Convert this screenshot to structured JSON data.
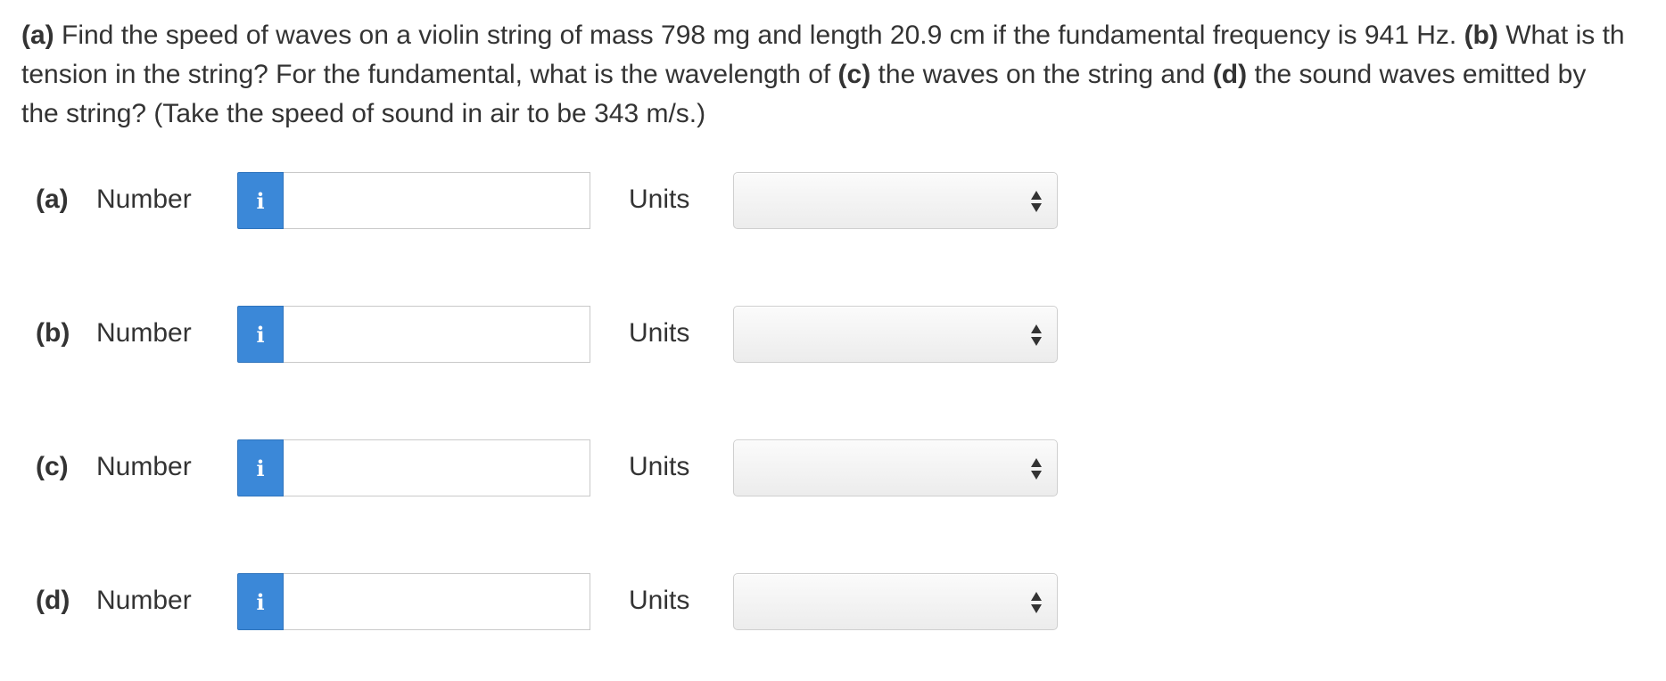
{
  "question": {
    "line1": [
      {
        "text": "(a)",
        "bold": true
      },
      {
        "text": " Find the speed of waves on a violin string of mass 798 mg and length 20.9 cm if the fundamental frequency is 941 Hz. ",
        "bold": false
      },
      {
        "text": "(b)",
        "bold": true
      },
      {
        "text": " What is th",
        "bold": false
      }
    ],
    "line2": [
      {
        "text": "tension in the string? For the fundamental, what is the wavelength of ",
        "bold": false
      },
      {
        "text": "(c)",
        "bold": true
      },
      {
        "text": " the waves on the string and ",
        "bold": false
      },
      {
        "text": "(d)",
        "bold": true
      },
      {
        "text": " the sound waves emitted by",
        "bold": false
      }
    ],
    "line3": [
      {
        "text": "the string? (Take the speed of sound in air to be 343 m/s.)",
        "bold": false
      }
    ]
  },
  "parts": [
    {
      "label": "(a)",
      "number_label": "Number",
      "info_icon_glyph": "i",
      "number_value": "",
      "units_label": "Units",
      "units_value": ""
    },
    {
      "label": "(b)",
      "number_label": "Number",
      "info_icon_glyph": "i",
      "number_value": "",
      "units_label": "Units",
      "units_value": ""
    },
    {
      "label": "(c)",
      "number_label": "Number",
      "info_icon_glyph": "i",
      "number_value": "",
      "units_label": "Units",
      "units_value": ""
    },
    {
      "label": "(d)",
      "number_label": "Number",
      "info_icon_glyph": "i",
      "number_value": "",
      "units_label": "Units",
      "units_value": ""
    }
  ],
  "icons": {
    "info": "info-icon",
    "select_arrows": "up-down-arrows-icon"
  },
  "colors": {
    "info_button": "#3b88d8",
    "text": "#333333",
    "input_border": "#c9c9c9"
  }
}
